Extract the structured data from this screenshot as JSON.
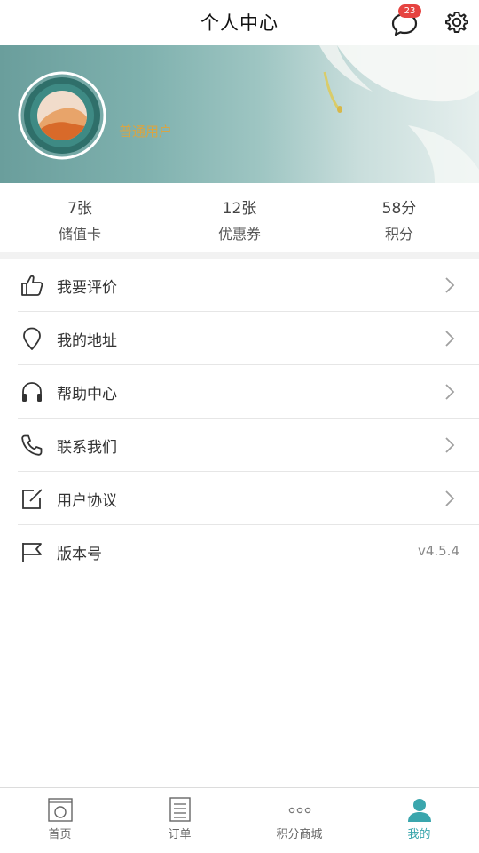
{
  "header": {
    "title": "个人中心",
    "message_badge": "23"
  },
  "profile": {
    "user_level": "普通用户"
  },
  "stats": [
    {
      "value": "7张",
      "label": "储值卡"
    },
    {
      "value": "12张",
      "label": "优惠券"
    },
    {
      "value": "58分",
      "label": "积分"
    }
  ],
  "menu": {
    "items": [
      {
        "label": "我要评价",
        "icon": "thumbs-up-icon"
      },
      {
        "label": "我的地址",
        "icon": "location-pin-icon"
      },
      {
        "label": "帮助中心",
        "icon": "headphones-icon"
      },
      {
        "label": "联系我们",
        "icon": "phone-icon"
      },
      {
        "label": "用户协议",
        "icon": "edit-icon"
      },
      {
        "label": "版本号",
        "icon": "flag-icon"
      }
    ],
    "version_value": "v4.5.4"
  },
  "tabbar": {
    "tabs": [
      {
        "label": "首页",
        "icon": "home-icon"
      },
      {
        "label": "订单",
        "icon": "order-list-icon"
      },
      {
        "label": "积分商城",
        "icon": "more-dots-icon"
      },
      {
        "label": "我的",
        "icon": "user-icon"
      }
    ],
    "active_color": "#3aa6ad"
  },
  "colors": {
    "accent": "#3aa6ad",
    "badge": "#e64340",
    "user_level": "#d7a545"
  }
}
